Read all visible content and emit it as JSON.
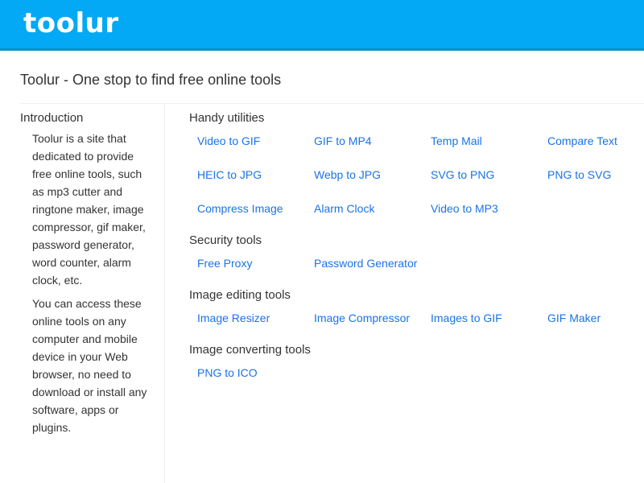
{
  "header": {
    "logo": "toolur",
    "brand_color": "#03a9f4"
  },
  "page": {
    "title": "Toolur - One stop to find free online tools"
  },
  "sidebar": {
    "heading": "Introduction",
    "paragraphs": [
      "Toolur is a site that dedicated to provide free online tools, such as mp3 cutter and ringtone maker, image compressor, gif maker, password generator, word counter, alarm clock, etc.",
      "You can access these online tools on any computer and mobile device in your Web browser, no need to download or install any software, apps or plugins."
    ]
  },
  "sections": [
    {
      "heading": "Handy utilities",
      "links": [
        "Video to GIF",
        "GIF to MP4",
        "Temp Mail",
        "Compare Text",
        "HEIC to JPG",
        "Webp to JPG",
        "SVG to PNG",
        "PNG to SVG",
        "Compress Image",
        "Alarm Clock",
        "Video to MP3"
      ]
    },
    {
      "heading": "Security tools",
      "links": [
        "Free Proxy",
        "Password Generator"
      ]
    },
    {
      "heading": "Image editing tools",
      "links": [
        "Image Resizer",
        "Image Compressor",
        "Images to GIF",
        "GIF Maker"
      ]
    },
    {
      "heading": "Image converting tools",
      "links": [
        "PNG to ICO"
      ]
    }
  ],
  "link_color": "#1a73e8"
}
